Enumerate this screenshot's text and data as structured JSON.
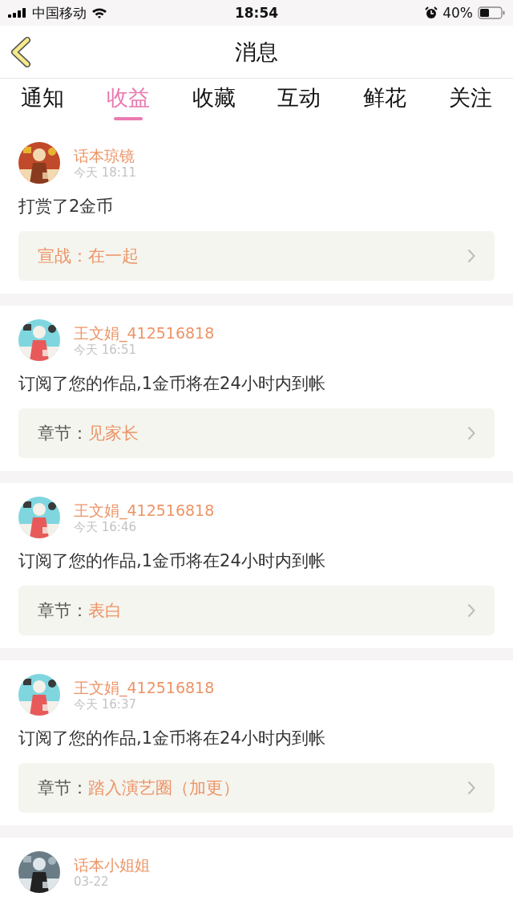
{
  "status_bar": {
    "carrier": "中国移动",
    "time": "18:54",
    "battery": "40%"
  },
  "nav": {
    "title": "消息"
  },
  "tabs": [
    {
      "label": "通知",
      "selected": false
    },
    {
      "label": "收益",
      "selected": true
    },
    {
      "label": "收藏",
      "selected": false
    },
    {
      "label": "互动",
      "selected": false
    },
    {
      "label": "鲜花",
      "selected": false
    },
    {
      "label": "关注",
      "selected": false
    }
  ],
  "messages": [
    {
      "user": "话本琼镜",
      "time": "今天 18:11",
      "text": "打赏了2金币",
      "link": {
        "kind": "challenge",
        "label": "宣战：",
        "value": "在一起"
      }
    },
    {
      "user": "王文娟_412516818",
      "time": "今天 16:51",
      "text": "订阅了您的作品,1金币将在24小时内到帐",
      "link": {
        "kind": "chapter",
        "label": "章节：",
        "value": "见家长"
      }
    },
    {
      "user": "王文娟_412516818",
      "time": "今天 16:46",
      "text": "订阅了您的作品,1金币将在24小时内到帐",
      "link": {
        "kind": "chapter",
        "label": "章节：",
        "value": "表白"
      }
    },
    {
      "user": "王文娟_412516818",
      "time": "今天 16:37",
      "text": "订阅了您的作品,1金币将在24小时内到帐",
      "link": {
        "kind": "chapter",
        "label": "章节：",
        "value": "踏入演艺圈（加更）"
      }
    },
    {
      "user": "话本小姐姐",
      "time": "03-22"
    }
  ]
}
